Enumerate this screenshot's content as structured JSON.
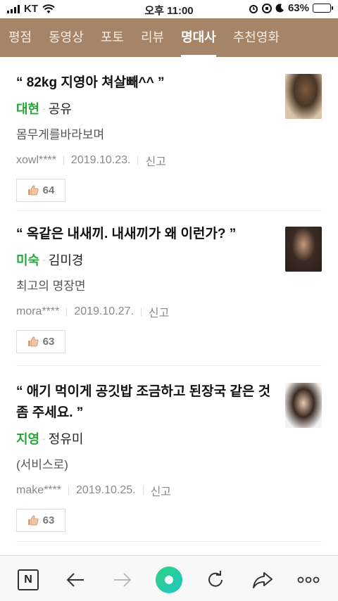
{
  "status": {
    "carrier": "KT",
    "time": "오후 11:00",
    "battery": "63%",
    "battery_level": 0.63
  },
  "tabs": [
    {
      "label": "평점"
    },
    {
      "label": "동영상"
    },
    {
      "label": "포토"
    },
    {
      "label": "리뷰"
    },
    {
      "label": "명대사",
      "active": true
    },
    {
      "label": "추천영화"
    }
  ],
  "quotes": [
    {
      "quote": "“ 82kg 지영아 쳐살빼^^ ”",
      "character": "대현",
      "actor": "공유",
      "content": "몸무게를바라보며",
      "user": "xowl****",
      "date": "2019.10.23.",
      "report": "신고",
      "likes": "64"
    },
    {
      "quote": "“ 옥같은 내새끼. 내새끼가 왜 이런가? ”",
      "character": "미숙",
      "actor": "김미경",
      "content": "최고의 명장면",
      "user": "mora****",
      "date": "2019.10.27.",
      "report": "신고",
      "likes": "63"
    },
    {
      "quote": "“ 애기 먹이게 공깃밥 조금하고 된장국 같은 것 좀 주세요. ”",
      "character": "지영",
      "actor": "정유미",
      "content": "(서비스로)",
      "user": "make****",
      "date": "2019.10.25.",
      "report": "신고",
      "likes": "63"
    }
  ],
  "colors": {
    "tab_bar": "#a58467",
    "character": "#23a635",
    "home_accent": "#2fd27f"
  }
}
